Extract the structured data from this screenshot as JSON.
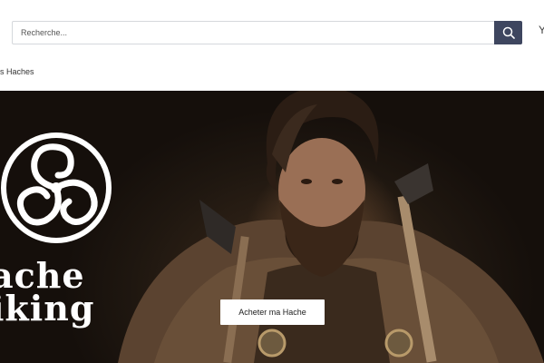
{
  "search": {
    "placeholder": "Recherche..."
  },
  "header": {
    "edge_glyph": "Y"
  },
  "nav": {
    "item": "os Haches"
  },
  "hero": {
    "brand_line1": "ache",
    "brand_line2": "iking",
    "cta_label": "Acheter ma Hache"
  },
  "colors": {
    "search_button": "#3e465f",
    "hero_bg": "#1f1710",
    "cta_bg": "#ffffff"
  }
}
